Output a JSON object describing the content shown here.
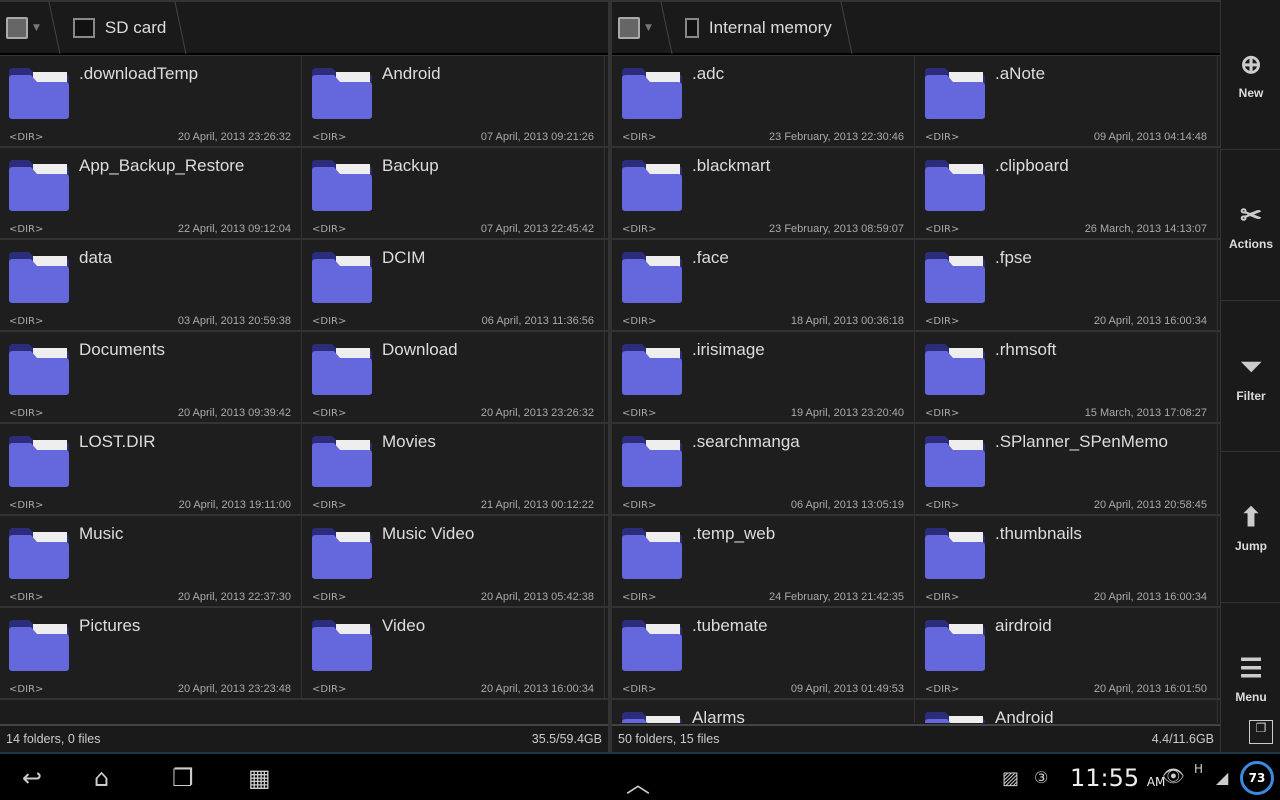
{
  "left": {
    "location": "SD card",
    "status_left": "14 folders, 0 files",
    "status_right": "35.5/59.4GB",
    "items": [
      {
        "name": ".downloadTemp",
        "type": "<DIR>",
        "date": "20 April, 2013 23:26:32"
      },
      {
        "name": "Android",
        "type": "<DIR>",
        "date": "07 April, 2013 09:21:26"
      },
      {
        "name": "App_Backup_Restore",
        "type": "<DIR>",
        "date": "22 April, 2013 09:12:04"
      },
      {
        "name": "Backup",
        "type": "<DIR>",
        "date": "07 April, 2013 22:45:42"
      },
      {
        "name": "data",
        "type": "<DIR>",
        "date": "03 April, 2013 20:59:38"
      },
      {
        "name": "DCIM",
        "type": "<DIR>",
        "date": "06 April, 2013 11:36:56"
      },
      {
        "name": "Documents",
        "type": "<DIR>",
        "date": "20 April, 2013 09:39:42"
      },
      {
        "name": "Download",
        "type": "<DIR>",
        "date": "20 April, 2013 23:26:32"
      },
      {
        "name": "LOST.DIR",
        "type": "<DIR>",
        "date": "20 April, 2013 19:11:00"
      },
      {
        "name": "Movies",
        "type": "<DIR>",
        "date": "21 April, 2013 00:12:22"
      },
      {
        "name": "Music",
        "type": "<DIR>",
        "date": "20 April, 2013 22:37:30"
      },
      {
        "name": "Music Video",
        "type": "<DIR>",
        "date": "20 April, 2013 05:42:38"
      },
      {
        "name": "Pictures",
        "type": "<DIR>",
        "date": "20 April, 2013 23:23:48"
      },
      {
        "name": "Video",
        "type": "<DIR>",
        "date": "20 April, 2013 16:00:34"
      }
    ]
  },
  "right": {
    "location": "Internal memory",
    "status_left": "50 folders, 15 files",
    "status_right": "4.4/11.6GB",
    "items": [
      {
        "name": ".adc",
        "type": "<DIR>",
        "date": "23 February, 2013 22:30:46"
      },
      {
        "name": ".aNote",
        "type": "<DIR>",
        "date": "09 April, 2013 04:14:48"
      },
      {
        "name": ".blackmart",
        "type": "<DIR>",
        "date": "23 February, 2013 08:59:07"
      },
      {
        "name": ".clipboard",
        "type": "<DIR>",
        "date": "26 March, 2013 14:13:07"
      },
      {
        "name": ".face",
        "type": "<DIR>",
        "date": "18 April, 2013 00:36:18"
      },
      {
        "name": ".fpse",
        "type": "<DIR>",
        "date": "20 April, 2013 16:00:34"
      },
      {
        "name": ".irisimage",
        "type": "<DIR>",
        "date": "19 April, 2013 23:20:40"
      },
      {
        "name": ".rhmsoft",
        "type": "<DIR>",
        "date": "15 March, 2013 17:08:27"
      },
      {
        "name": ".searchmanga",
        "type": "<DIR>",
        "date": "06 April, 2013 13:05:19"
      },
      {
        "name": ".SPlanner_SPenMemo",
        "type": "<DIR>",
        "date": "20 April, 2013 20:58:45"
      },
      {
        "name": ".temp_web",
        "type": "<DIR>",
        "date": "24 February, 2013 21:42:35"
      },
      {
        "name": ".thumbnails",
        "type": "<DIR>",
        "date": "20 April, 2013 16:00:34"
      },
      {
        "name": ".tubemate",
        "type": "<DIR>",
        "date": "09 April, 2013 01:49:53"
      },
      {
        "name": "airdroid",
        "type": "<DIR>",
        "date": "20 April, 2013 16:01:50"
      },
      {
        "name": "Alarms",
        "type": "",
        "date": ""
      },
      {
        "name": "Android",
        "type": "",
        "date": ""
      }
    ]
  },
  "sidebar": [
    {
      "label": "New",
      "icon": "plus-circle-icon",
      "glyph": "⊕"
    },
    {
      "label": "Actions",
      "icon": "tools-icon",
      "glyph": "✂"
    },
    {
      "label": "Filter",
      "icon": "filter-icon",
      "glyph": "⏷"
    },
    {
      "label": "Jump",
      "icon": "arrow-up-icon",
      "glyph": "⬆"
    },
    {
      "label": "Menu",
      "icon": "menu-icon",
      "glyph": "☰"
    }
  ],
  "system": {
    "time": "11:55",
    "ampm": "AM",
    "battery": "73",
    "signal": "H"
  },
  "colors": {
    "folder": "#5b5fd6",
    "background": "#1e1e1e"
  }
}
